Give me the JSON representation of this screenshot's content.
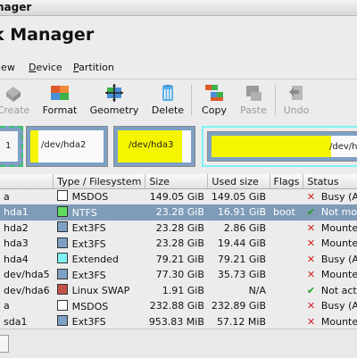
{
  "window": {
    "title": "nager"
  },
  "header": {
    "title": "k Manager"
  },
  "menu": [
    {
      "pre": "",
      "u": "",
      "post": "iew"
    },
    {
      "pre": "",
      "u": "D",
      "post": "evice"
    },
    {
      "pre": "",
      "u": "P",
      "post": "artition"
    }
  ],
  "toolbar": {
    "create": "Create",
    "format": "Format",
    "geometry": "Geometry",
    "delete": "Delete",
    "copy": "Copy",
    "paste": "Paste",
    "undo": "Undo"
  },
  "colors": {
    "ntfs": "#5fdc5f",
    "ext3": "#7da0c4",
    "extended": "#7ff3f3",
    "swap": "#c35248",
    "msdos": "#ffffff",
    "used": "#f5f500",
    "selected": "#7f9bb8",
    "busy": "#d02020",
    "ok": "#20a020"
  },
  "diskmap": {
    "p1_label": "1",
    "p2_label": "/dev/hda2",
    "p3_label": "/dev/hda3",
    "p4_label": "/dev/hda"
  },
  "table": {
    "headers": [
      "",
      "Type / Filesystem",
      "Size",
      "Used size",
      "Flags",
      "Status"
    ],
    "rows": [
      {
        "name": "a",
        "fs": "MSDOS",
        "color": "#ffffff",
        "size": "149.05 GiB",
        "used": "149.05 GiB",
        "flags": "",
        "icon": "✕",
        "icon_color": "#d02020",
        "status": "Busy (A"
      },
      {
        "name": "hda1",
        "fs": "NTFS",
        "color": "#5fdc5f",
        "size": "23.28 GiB",
        "used": "16.91 GiB",
        "flags": "boot",
        "icon": "✔",
        "icon_color": "#20a020",
        "status": "Not mou"
      },
      {
        "name": "hda2",
        "fs": "Ext3FS",
        "color": "#7da0c4",
        "size": "23.28 GiB",
        "used": "2.86 GiB",
        "flags": "",
        "icon": "✕",
        "icon_color": "#d02020",
        "status": "Mounted"
      },
      {
        "name": "hda3",
        "fs": "Ext3FS",
        "color": "#7da0c4",
        "size": "23.28 GiB",
        "used": "19.44 GiB",
        "flags": "",
        "icon": "✕",
        "icon_color": "#d02020",
        "status": "Mounted"
      },
      {
        "name": "hda4",
        "fs": "Extended",
        "color": "#7ff3f3",
        "size": "79.21 GiB",
        "used": "79.21 GiB",
        "flags": "",
        "icon": "✕",
        "icon_color": "#d02020",
        "status": "Busy (A"
      },
      {
        "name": "dev/hda5",
        "fs": "Ext3FS",
        "color": "#7da0c4",
        "size": "77.30 GiB",
        "used": "35.73 GiB",
        "flags": "",
        "icon": "✕",
        "icon_color": "#d02020",
        "status": "Mounted"
      },
      {
        "name": "dev/hda6",
        "fs": "Linux SWAP",
        "color": "#c35248",
        "size": "1.91 GiB",
        "used": "N/A",
        "flags": "",
        "icon": "✔",
        "icon_color": "#20a020",
        "status": "Not acti"
      },
      {
        "name": "a",
        "fs": "MSDOS",
        "color": "#ffffff",
        "size": "232.88 GiB",
        "used": "232.89 GiB",
        "flags": "",
        "icon": "✕",
        "icon_color": "#d02020",
        "status": "Busy (A"
      },
      {
        "name": "sda1",
        "fs": "Ext3FS",
        "color": "#7da0c4",
        "size": "953.83 MiB",
        "used": "57.12 MiB",
        "flags": "",
        "icon": "✕",
        "icon_color": "#d02020",
        "status": "Mounted"
      }
    ]
  }
}
